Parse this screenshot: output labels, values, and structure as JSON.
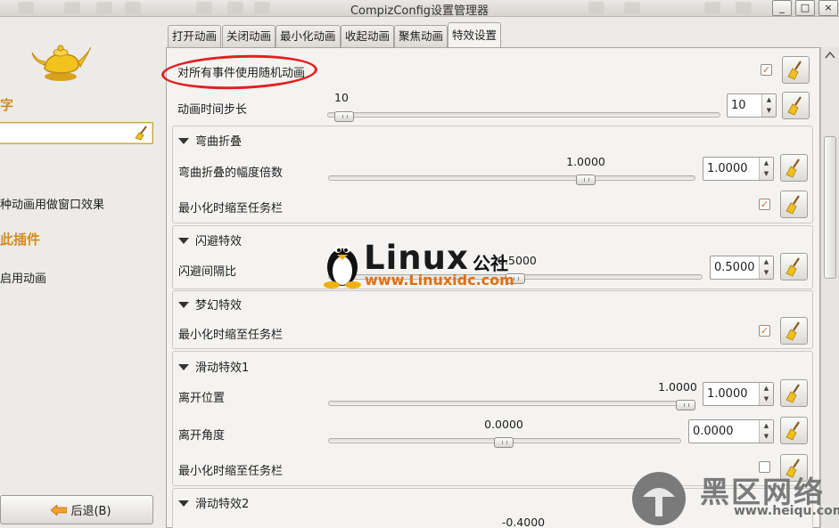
{
  "window": {
    "title": "CompizConfig设置管理器"
  },
  "left": {
    "heading1": "字",
    "text1": "种动画用做窗口效果",
    "heading2": "此插件",
    "text2": "启用动画",
    "back_label": "后退(B)"
  },
  "tabs": [
    {
      "label": "打开动画"
    },
    {
      "label": "关闭动画"
    },
    {
      "label": "最小化动画"
    },
    {
      "label": "收起动画"
    },
    {
      "label": "聚焦动画"
    },
    {
      "label": "特效设置"
    }
  ],
  "settings": {
    "random_label": "对所有事件使用随机动画",
    "random_checked": true,
    "step_label": "动画时间步长",
    "step_value": "10",
    "step_input": "10",
    "step_fraction": 0.02
  },
  "groups": {
    "curved": {
      "title": "弯曲折叠",
      "amp_label": "弯曲折叠的幅度倍数",
      "amp_value": "1.0000",
      "amp_input": "1.0000",
      "minimize_label": "最小化时缩至任务栏",
      "minimize_checked": true
    },
    "dodge": {
      "title": "闪避特效",
      "gap_label": "闪避间隔比",
      "gap_value": "0.5000",
      "gap_input": "0.5000"
    },
    "dream": {
      "title": "梦幻特效",
      "minimize_label": "最小化时缩至任务栏",
      "minimize_checked": true
    },
    "glide1": {
      "title": "滑动特效1",
      "pos_label": "离开位置",
      "pos_value": "1.0000",
      "pos_input": "1.0000",
      "angle_label": "离开角度",
      "angle_value": "0.0000",
      "angle_input": "0.0000",
      "minimize_label": "最小化时缩至任务栏",
      "minimize_checked": false
    },
    "glide2": {
      "title": "滑动特效2",
      "partial_value": "-0.4000"
    }
  },
  "watermarks": {
    "linux_text": "Linux",
    "linux_cn": "公社",
    "linux_url": "www.Linuxidc.com",
    "heiqu_cn": "黑区网络",
    "heiqu_url": "www.heiqu.com"
  },
  "colors": {
    "accent": "#d18b1f",
    "check": "#d6681b",
    "annotation": "#e31f1f"
  }
}
